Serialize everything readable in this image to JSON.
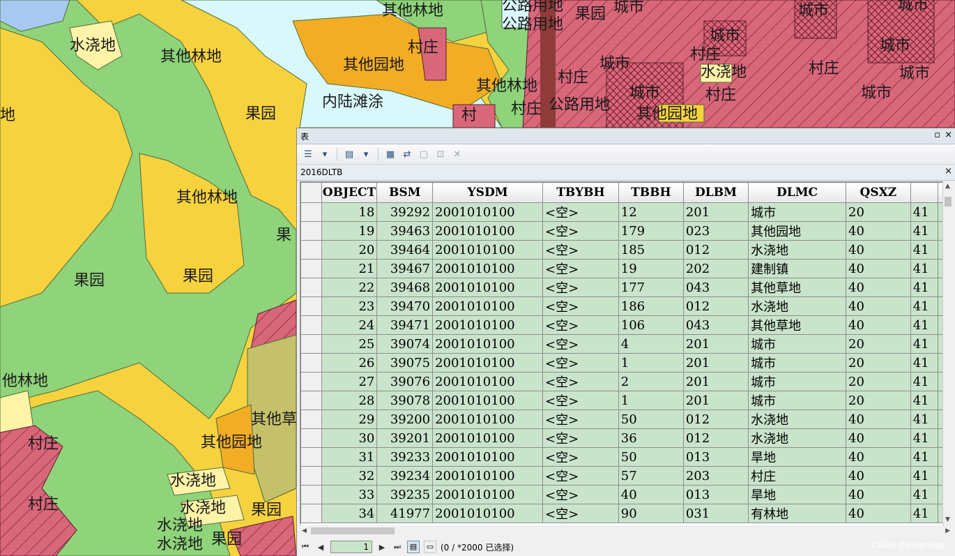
{
  "map": {
    "labels": [
      {
        "text": "水浇地"
      },
      {
        "text": "其他林地"
      },
      {
        "text": "其他林地"
      },
      {
        "text": "其他园地"
      },
      {
        "text": "村庄"
      },
      {
        "text": "内陆滩涂"
      },
      {
        "text": "果园"
      },
      {
        "text": "其他林地"
      },
      {
        "text": "其他林地"
      },
      {
        "text": "果园"
      },
      {
        "text": "果园"
      },
      {
        "text": "他林地"
      },
      {
        "text": "村庄"
      },
      {
        "text": "村庄"
      },
      {
        "text": "其他园地"
      },
      {
        "text": "水浇地"
      },
      {
        "text": "水浇地"
      },
      {
        "text": "水浇地"
      },
      {
        "text": "水浇地"
      },
      {
        "text": "果园"
      },
      {
        "text": "果园"
      },
      {
        "text": "其他草"
      },
      {
        "text": "公路用地"
      },
      {
        "text": "公路用地"
      },
      {
        "text": "果园"
      },
      {
        "text": "城市"
      },
      {
        "text": "城市"
      },
      {
        "text": "城市"
      },
      {
        "text": "城市"
      },
      {
        "text": "城市"
      },
      {
        "text": "城市"
      },
      {
        "text": "城市"
      },
      {
        "text": "城市"
      },
      {
        "text": "村庄"
      },
      {
        "text": "村庄"
      },
      {
        "text": "村庄"
      },
      {
        "text": "村庄"
      },
      {
        "text": "村庄"
      },
      {
        "text": "水浇地"
      },
      {
        "text": "公路用地"
      },
      {
        "text": "其他园地"
      },
      {
        "text": "城市"
      },
      {
        "text": "地"
      },
      {
        "text": "果"
      },
      {
        "text": "村"
      }
    ]
  },
  "window": {
    "title": "表",
    "restore_glyph": "▫",
    "close_glyph": "×",
    "tab_name": "2016DLTB",
    "tab_close_glyph": "×"
  },
  "table": {
    "columns": [
      "OBJECT",
      "BSM",
      "YSDM",
      "TBYBH",
      "TBBH",
      "DLBM",
      "DLMC",
      "QSXZ",
      ""
    ],
    "rows": [
      [
        "18",
        "39292",
        "2001010100",
        "<空>",
        "12",
        "201",
        "城市",
        "20",
        "41"
      ],
      [
        "19",
        "39463",
        "2001010100",
        "<空>",
        "179",
        "023",
        "其他园地",
        "40",
        "41"
      ],
      [
        "20",
        "39464",
        "2001010100",
        "<空>",
        "185",
        "012",
        "水浇地",
        "40",
        "41"
      ],
      [
        "21",
        "39467",
        "2001010100",
        "<空>",
        "19",
        "202",
        "建制镇",
        "40",
        "41"
      ],
      [
        "22",
        "39468",
        "2001010100",
        "<空>",
        "177",
        "043",
        "其他草地",
        "40",
        "41"
      ],
      [
        "23",
        "39470",
        "2001010100",
        "<空>",
        "186",
        "012",
        "水浇地",
        "40",
        "41"
      ],
      [
        "24",
        "39471",
        "2001010100",
        "<空>",
        "106",
        "043",
        "其他草地",
        "40",
        "41"
      ],
      [
        "25",
        "39074",
        "2001010100",
        "<空>",
        "4",
        "201",
        "城市",
        "20",
        "41"
      ],
      [
        "26",
        "39075",
        "2001010100",
        "<空>",
        "1",
        "201",
        "城市",
        "20",
        "41"
      ],
      [
        "27",
        "39076",
        "2001010100",
        "<空>",
        "2",
        "201",
        "城市",
        "20",
        "41"
      ],
      [
        "28",
        "39078",
        "2001010100",
        "<空>",
        "1",
        "201",
        "城市",
        "20",
        "41"
      ],
      [
        "29",
        "39200",
        "2001010100",
        "<空>",
        "50",
        "012",
        "水浇地",
        "40",
        "41"
      ],
      [
        "30",
        "39201",
        "2001010100",
        "<空>",
        "36",
        "012",
        "水浇地",
        "40",
        "41"
      ],
      [
        "31",
        "39233",
        "2001010100",
        "<空>",
        "50",
        "013",
        "旱地",
        "40",
        "41"
      ],
      [
        "32",
        "39234",
        "2001010100",
        "<空>",
        "57",
        "203",
        "村庄",
        "40",
        "41"
      ],
      [
        "33",
        "39235",
        "2001010100",
        "<空>",
        "40",
        "013",
        "旱地",
        "40",
        "41"
      ],
      [
        "34",
        "41977",
        "2001010100",
        "<空>",
        "90",
        "031",
        "有林地",
        "40",
        "41"
      ]
    ]
  },
  "statusbar": {
    "current_record": "1",
    "selection_text": "(0 / *2000 已选择)",
    "nav_first": "⏮",
    "nav_prev": "◀",
    "nav_next": "▶",
    "nav_last": "⏭"
  },
  "watermark": "CSDN @yongshiqq"
}
